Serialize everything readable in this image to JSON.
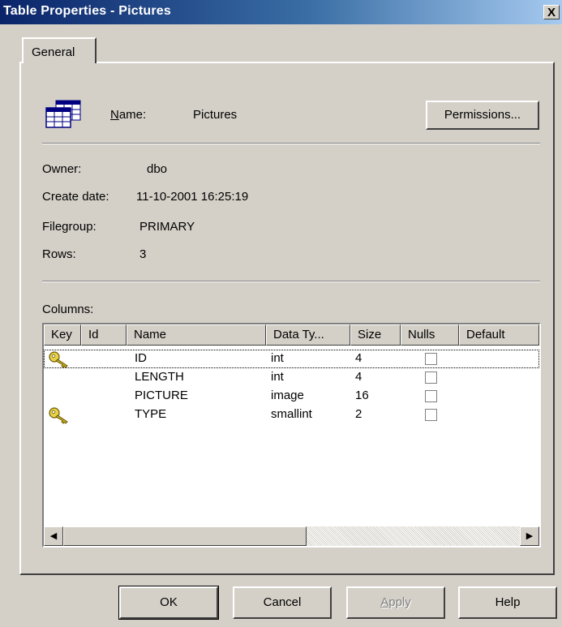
{
  "window": {
    "title": "Table Properties - Pictures",
    "close_glyph": "X"
  },
  "tabs": [
    {
      "label": "General"
    }
  ],
  "general": {
    "name_label": "Name:",
    "name_value": "Pictures",
    "permissions_button": "Permissions...",
    "owner_label": "Owner:",
    "owner_value": "dbo",
    "create_date_label": "Create date:",
    "create_date_value": "11-10-2001 16:25:19",
    "filegroup_label": "Filegroup:",
    "filegroup_value": "PRIMARY",
    "rows_label": "Rows:",
    "rows_value": "3",
    "columns_label": "Columns:"
  },
  "columns_table": {
    "headers": [
      "Key",
      "Id",
      "Name",
      "Data Ty...",
      "Size",
      "Nulls",
      "Default"
    ],
    "rows": [
      {
        "key": true,
        "id": "",
        "name": "ID",
        "data_type": "int",
        "size": "4",
        "nulls": false,
        "default": "",
        "selected": true
      },
      {
        "key": false,
        "id": "",
        "name": "LENGTH",
        "data_type": "int",
        "size": "4",
        "nulls": false,
        "default": ""
      },
      {
        "key": false,
        "id": "",
        "name": "PICTURE",
        "data_type": "image",
        "size": "16",
        "nulls": false,
        "default": ""
      },
      {
        "key": true,
        "id": "",
        "name": "TYPE",
        "data_type": "smallint",
        "size": "2",
        "nulls": false,
        "default": ""
      }
    ]
  },
  "buttons": {
    "ok": "OK",
    "cancel": "Cancel",
    "apply": "Apply",
    "help": "Help"
  },
  "colors": {
    "title_start": "#0a246a",
    "title_end": "#a6caf0",
    "face": "#d4d0c8"
  },
  "icons": {
    "table": "table-icon",
    "key": "key-icon"
  }
}
